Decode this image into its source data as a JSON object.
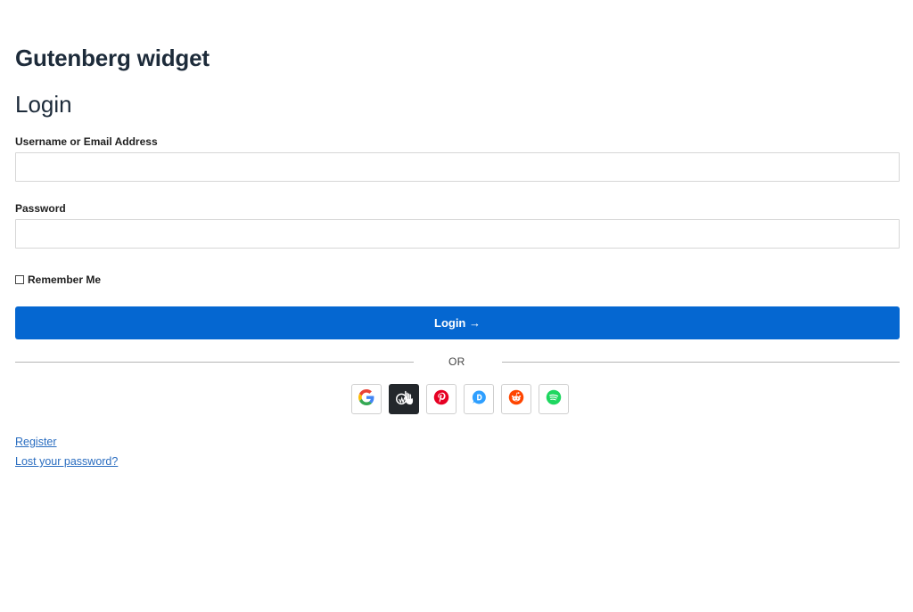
{
  "widget_title": "Gutenberg widget",
  "form": {
    "title": "Login",
    "username_label": "Username or Email Address",
    "username_value": "",
    "password_label": "Password",
    "password_value": "",
    "remember_label": "Remember Me",
    "remember_checked": false,
    "submit_label": "Login →"
  },
  "divider_text": "OR",
  "social_buttons": [
    {
      "name": "google-icon",
      "color": "#4285f4"
    },
    {
      "name": "wordpress-icon",
      "color": "#ffffff"
    },
    {
      "name": "pinterest-icon",
      "color": "#e60023"
    },
    {
      "name": "disqus-icon",
      "color": "#2e9fff"
    },
    {
      "name": "reddit-icon",
      "color": "#ff4500"
    },
    {
      "name": "spotify-icon",
      "color": "#1ed760"
    }
  ],
  "links": {
    "register": "Register",
    "lost_password": "Lost your password?"
  },
  "colors": {
    "primary": "#0567d1",
    "link": "#2a6dc0",
    "heading": "#1d2b3a"
  }
}
